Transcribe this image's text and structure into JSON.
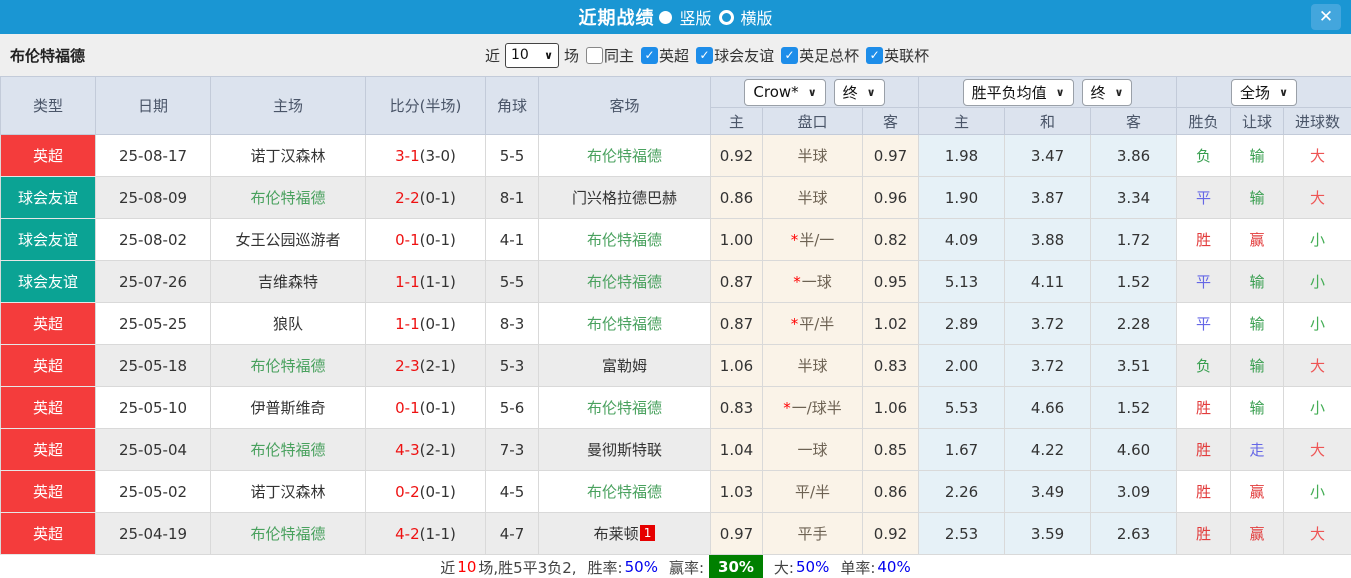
{
  "icons": {
    "chevron_down": "∨",
    "check": "✓",
    "close": "✕",
    "radio_selected": "filled-circle",
    "radio_unselected": "hollow-circle"
  },
  "colors": {
    "titlebar_blue": "#1a96d3",
    "header_bg": "#dce3ee",
    "filter_bg": "#efefef",
    "handicap_col_bg": "#faf3e8",
    "avg_col_bg": "#e6f1f7",
    "alt_row_bg": "#ececec",
    "team_highlight_green": "#49a15e",
    "score_red": "#ee1111",
    "summary_value_blue": "#0000ee",
    "summary_badge_green": "#008000",
    "away_badge_red": "#e60000"
  },
  "titlebar": {
    "title": "近期战绩",
    "vertical_label": "竖版",
    "horizontal_label": "横版"
  },
  "filter": {
    "team": "布伦特福德",
    "near_label": "近",
    "near_value": "10",
    "games_label": "场",
    "same_home_label": "同主",
    "leagues": [
      "英超",
      "球会友谊",
      "英足总杯",
      "英联杯"
    ]
  },
  "controls": {
    "bookmaker": "Crow*",
    "final1": "终",
    "avg_label": "胜平负均值",
    "final2": "终",
    "scope": "全场"
  },
  "headers": {
    "type": "类型",
    "date": "日期",
    "home": "主场",
    "score": "比分(半场)",
    "corner": "角球",
    "away": "客场",
    "odds_home": "主",
    "handicap": "盘口",
    "odds_away": "客",
    "avg_home": "主",
    "avg_draw": "和",
    "avg_away": "客",
    "result": "胜负",
    "handicap_result": "让球",
    "goals": "进球数"
  },
  "type_colors": {
    "英超": "#f43c3c",
    "球会友谊": "#0ba394"
  },
  "value_colors": {
    "胜": "red",
    "赢": "red",
    "大": "red2",
    "平": "blu",
    "走": "blu",
    "负": "grn",
    "输": "grn",
    "小": "grn2"
  },
  "rows": [
    {
      "type": "英超",
      "date": "25-08-17",
      "home": "诺丁汉森林",
      "home_hl": false,
      "score": "3-1",
      "half": "(3-0)",
      "corner": "5-5",
      "away": "布伦特福德",
      "away_hl": true,
      "away_badge": "",
      "h_odds": "0.92",
      "handicap_star": false,
      "handicap": "半球",
      "a_odds": "0.97",
      "avg_h": "1.98",
      "avg_d": "3.47",
      "avg_a": "3.86",
      "result": "负",
      "hres": "输",
      "goals": "大"
    },
    {
      "type": "球会友谊",
      "date": "25-08-09",
      "home": "布伦特福德",
      "home_hl": true,
      "score": "2-2",
      "half": "(0-1)",
      "corner": "8-1",
      "away": "门兴格拉德巴赫",
      "away_hl": false,
      "away_badge": "",
      "h_odds": "0.86",
      "handicap_star": false,
      "handicap": "半球",
      "a_odds": "0.96",
      "avg_h": "1.90",
      "avg_d": "3.87",
      "avg_a": "3.34",
      "result": "平",
      "hres": "输",
      "goals": "大"
    },
    {
      "type": "球会友谊",
      "date": "25-08-02",
      "home": "女王公园巡游者",
      "home_hl": false,
      "score": "0-1",
      "half": "(0-1)",
      "corner": "4-1",
      "away": "布伦特福德",
      "away_hl": true,
      "away_badge": "",
      "h_odds": "1.00",
      "handicap_star": true,
      "handicap": "半/一",
      "a_odds": "0.82",
      "avg_h": "4.09",
      "avg_d": "3.88",
      "avg_a": "1.72",
      "result": "胜",
      "hres": "赢",
      "goals": "小"
    },
    {
      "type": "球会友谊",
      "date": "25-07-26",
      "home": "吉维森特",
      "home_hl": false,
      "score": "1-1",
      "half": "(1-1)",
      "corner": "5-5",
      "away": "布伦特福德",
      "away_hl": true,
      "away_badge": "",
      "h_odds": "0.87",
      "handicap_star": true,
      "handicap": "一球",
      "a_odds": "0.95",
      "avg_h": "5.13",
      "avg_d": "4.11",
      "avg_a": "1.52",
      "result": "平",
      "hres": "输",
      "goals": "小"
    },
    {
      "type": "英超",
      "date": "25-05-25",
      "home": "狼队",
      "home_hl": false,
      "score": "1-1",
      "half": "(0-1)",
      "corner": "8-3",
      "away": "布伦特福德",
      "away_hl": true,
      "away_badge": "",
      "h_odds": "0.87",
      "handicap_star": true,
      "handicap": "平/半",
      "a_odds": "1.02",
      "avg_h": "2.89",
      "avg_d": "3.72",
      "avg_a": "2.28",
      "result": "平",
      "hres": "输",
      "goals": "小"
    },
    {
      "type": "英超",
      "date": "25-05-18",
      "home": "布伦特福德",
      "home_hl": true,
      "score": "2-3",
      "half": "(2-1)",
      "corner": "5-3",
      "away": "富勒姆",
      "away_hl": false,
      "away_badge": "",
      "h_odds": "1.06",
      "handicap_star": false,
      "handicap": "半球",
      "a_odds": "0.83",
      "avg_h": "2.00",
      "avg_d": "3.72",
      "avg_a": "3.51",
      "result": "负",
      "hres": "输",
      "goals": "大"
    },
    {
      "type": "英超",
      "date": "25-05-10",
      "home": "伊普斯维奇",
      "home_hl": false,
      "score": "0-1",
      "half": "(0-1)",
      "corner": "5-6",
      "away": "布伦特福德",
      "away_hl": true,
      "away_badge": "",
      "h_odds": "0.83",
      "handicap_star": true,
      "handicap": "一/球半",
      "a_odds": "1.06",
      "avg_h": "5.53",
      "avg_d": "4.66",
      "avg_a": "1.52",
      "result": "胜",
      "hres": "输",
      "goals": "小"
    },
    {
      "type": "英超",
      "date": "25-05-04",
      "home": "布伦特福德",
      "home_hl": true,
      "score": "4-3",
      "half": "(2-1)",
      "corner": "7-3",
      "away": "曼彻斯特联",
      "away_hl": false,
      "away_badge": "",
      "h_odds": "1.04",
      "handicap_star": false,
      "handicap": "一球",
      "a_odds": "0.85",
      "avg_h": "1.67",
      "avg_d": "4.22",
      "avg_a": "4.60",
      "result": "胜",
      "hres": "走",
      "goals": "大"
    },
    {
      "type": "英超",
      "date": "25-05-02",
      "home": "诺丁汉森林",
      "home_hl": false,
      "score": "0-2",
      "half": "(0-1)",
      "corner": "4-5",
      "away": "布伦特福德",
      "away_hl": true,
      "away_badge": "",
      "h_odds": "1.03",
      "handicap_star": false,
      "handicap": "平/半",
      "a_odds": "0.86",
      "avg_h": "2.26",
      "avg_d": "3.49",
      "avg_a": "3.09",
      "result": "胜",
      "hres": "赢",
      "goals": "小"
    },
    {
      "type": "英超",
      "date": "25-04-19",
      "home": "布伦特福德",
      "home_hl": true,
      "score": "4-2",
      "half": "(1-1)",
      "corner": "4-7",
      "away": "布莱顿",
      "away_hl": false,
      "away_badge": "1",
      "h_odds": "0.97",
      "handicap_star": false,
      "handicap": "平手",
      "a_odds": "0.92",
      "avg_h": "2.53",
      "avg_d": "3.59",
      "avg_a": "2.63",
      "result": "胜",
      "hres": "赢",
      "goals": "大"
    }
  ],
  "summary": {
    "near_label": "近",
    "near_count": "10",
    "record": "场,胜5平3负2,",
    "winrate_label": "胜率:",
    "winrate_value": "50%",
    "oddswin_label": "赢率:",
    "oddswin_value": "30%",
    "big_label": "大:",
    "big_value": "50%",
    "single_label": "单率:",
    "single_value": "40%"
  }
}
